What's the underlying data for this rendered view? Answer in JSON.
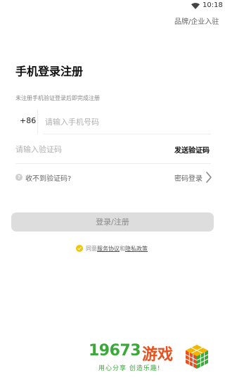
{
  "status_bar": {
    "time": "10:18",
    "wifi_icon": "wifi-icon"
  },
  "header": {
    "brand_entry": "品牌/企业入驻"
  },
  "main": {
    "title": "手机登录注册",
    "hint": "未注册手机验证登录后即完成注册",
    "phone": {
      "country_code": "+86",
      "placeholder": "请输入手机号码",
      "value": ""
    },
    "verify_code": {
      "placeholder": "请输入验证码",
      "value": "",
      "send_label": "发送验证码"
    },
    "no_code_label": "收不到验证码?",
    "password_login_label": "密码登录",
    "submit_label": "登录/注册",
    "agreement": {
      "checked": true,
      "prefix": "同意",
      "service_link": "服务协议",
      "and": "和",
      "privacy_link": "隐私政策"
    }
  },
  "watermark": {
    "number": "19673",
    "name": "游戏",
    "slogan": "用心分享 创造乐趣!"
  },
  "colors": {
    "accent_check": "#f5c400",
    "button_disabled_bg": "#dddddd",
    "watermark_green": "#3aa93a",
    "watermark_orange": "#e8501e"
  }
}
